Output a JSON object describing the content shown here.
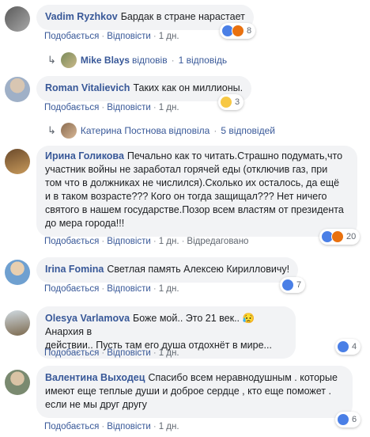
{
  "comments": [
    {
      "author": "Vadim Ryzhkov",
      "text": "Бардак в стране нарастает",
      "like": "Подобається",
      "reply": "Відповісти",
      "time": "1 дн.",
      "reactions": "8",
      "reply_thread": {
        "name": "Mike Blays",
        "verb": "відповів",
        "count": "1 відповідь"
      }
    },
    {
      "author": "Roman Vitalievich",
      "text": "Таких как он миллионы.",
      "like": "Подобається",
      "reply": "Відповісти",
      "time": "1 дн.",
      "reactions": "3",
      "reply_thread": {
        "name": "Катерина Постнова",
        "verb": "відповіла",
        "count": "5 відповідей"
      }
    },
    {
      "author": "Ирина Голикова",
      "line1": "Печально как то читать.Страшно подумать,что",
      "line2": "участник войны не заработал горячей еды (отключив газ, при",
      "line3": "том что в должниках не числился).Сколько их осталось, да ещё",
      "line4": "и в таком возрасте??? Кого он тогда защищал??? Нет ничего",
      "line5": "святого в нашем государстве.Позор всем властям от президента",
      "line6": "до мера города!!!",
      "like": "Подобається",
      "reply": "Відповісти",
      "time": "1 дн.",
      "edited": "Відредаговано",
      "reactions": "20"
    },
    {
      "author": "Irina Fomina",
      "text": "Светлая память Алексею Кирилловичу!",
      "like": "Подобається",
      "reply": "Відповісти",
      "time": "1 дн.",
      "reactions": "7"
    },
    {
      "author": "Olesya Varlamova",
      "line1": "Боже мой.. Это 21 век.. 😥 Анархия в",
      "line2": "действии.. Пусть там его душа отдохнёт в мире...",
      "like": "Подобається",
      "reply": "Відповісти",
      "time": "1 дн.",
      "reactions": "4"
    },
    {
      "author": "Валентина Выходец",
      "line1": "Спасибо всем неравнодушным . которые",
      "line2": "имеют еще теплые души и доброе сердце , кто еще поможет .",
      "line3": "если не мы друг другу",
      "like": "Подобається",
      "reply": "Відповісти",
      "time": "1 дн.",
      "reactions": "6"
    }
  ],
  "colors": {
    "link": "#385898",
    "bubble": "#f2f3f5",
    "meta": "#606770"
  }
}
